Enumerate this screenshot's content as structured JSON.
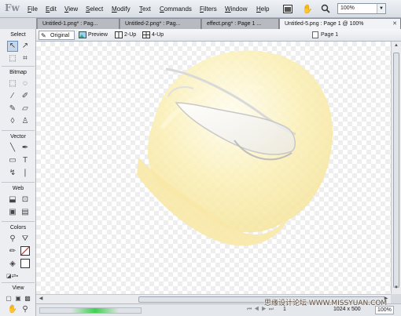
{
  "app": {
    "logo": "Fw"
  },
  "menu": [
    "File",
    "Edit",
    "View",
    "Select",
    "Modify",
    "Text",
    "Commands",
    "Filters",
    "Window",
    "Help"
  ],
  "toolbar": {
    "zoom_value": "100%"
  },
  "tabs": [
    {
      "label": "Untitled-1.png* : Pag...",
      "active": false
    },
    {
      "label": "Untitled-2.png* : Pag...",
      "active": false
    },
    {
      "label": "effect.png* : Page 1 ...",
      "active": false
    },
    {
      "label": "Untitled-5.png : Page 1 @ 100%",
      "active": true
    }
  ],
  "viewbar": {
    "original": "Original",
    "preview": "Preview",
    "two_up": "2-Up",
    "four_up": "4-Up",
    "page": "Page 1"
  },
  "tools": {
    "select": "Select",
    "bitmap": "Bitmap",
    "vector": "Vector",
    "web": "Web",
    "colors": "Colors",
    "view": "View"
  },
  "status": {
    "frame": "1",
    "size": "1024 x 500",
    "zoom": "100%"
  },
  "progress": {
    "position": 0.55
  },
  "watermark": "思缘设计论坛 WWW.MISSYUAN.COM",
  "colors": {
    "helmet": "#fbf0b8",
    "accent": "#6c8fb8"
  }
}
